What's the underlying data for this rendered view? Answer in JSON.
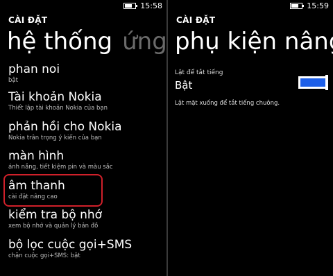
{
  "left": {
    "status": {
      "time": "15:58",
      "battery_level": 0.7
    },
    "app_title": "CÀI ĐẶT",
    "pivot": {
      "active": "hệ thống",
      "inactive": "ứng d"
    },
    "items": [
      {
        "title": "phan noi",
        "subtitle": "bật"
      },
      {
        "title": "Tài khoản Nokia",
        "subtitle": "Thiết lập tài khoản Nokia của bạn"
      },
      {
        "title": "phản hồi cho Nokia",
        "subtitle": "Nokia trân trọng ý kiến của bạn"
      },
      {
        "title": "màn hình",
        "subtitle": "ánh nắng, tiết kiệm pin và màu sắc"
      },
      {
        "title": "âm thanh",
        "subtitle": "cài đặt nâng cao"
      },
      {
        "title": "kiểm tra bộ nhớ",
        "subtitle": "xem bộ nhớ và quản lý bản đồ"
      },
      {
        "title": "bộ lọc cuộc gọi+SMS",
        "subtitle": "chặn cuộc gọi+SMS: bật"
      }
    ]
  },
  "right": {
    "status": {
      "time": "15:59",
      "battery_level": 0.7
    },
    "app_title": "CÀI ĐẶT",
    "page_title": "phụ kiện nâng",
    "setting": {
      "label": "Lật để tắt tiếng",
      "state": "Bật",
      "on": true,
      "description": "Lật mặt xuống để tắt tiếng chuông."
    },
    "toggle_color": "#1c5ee8"
  }
}
